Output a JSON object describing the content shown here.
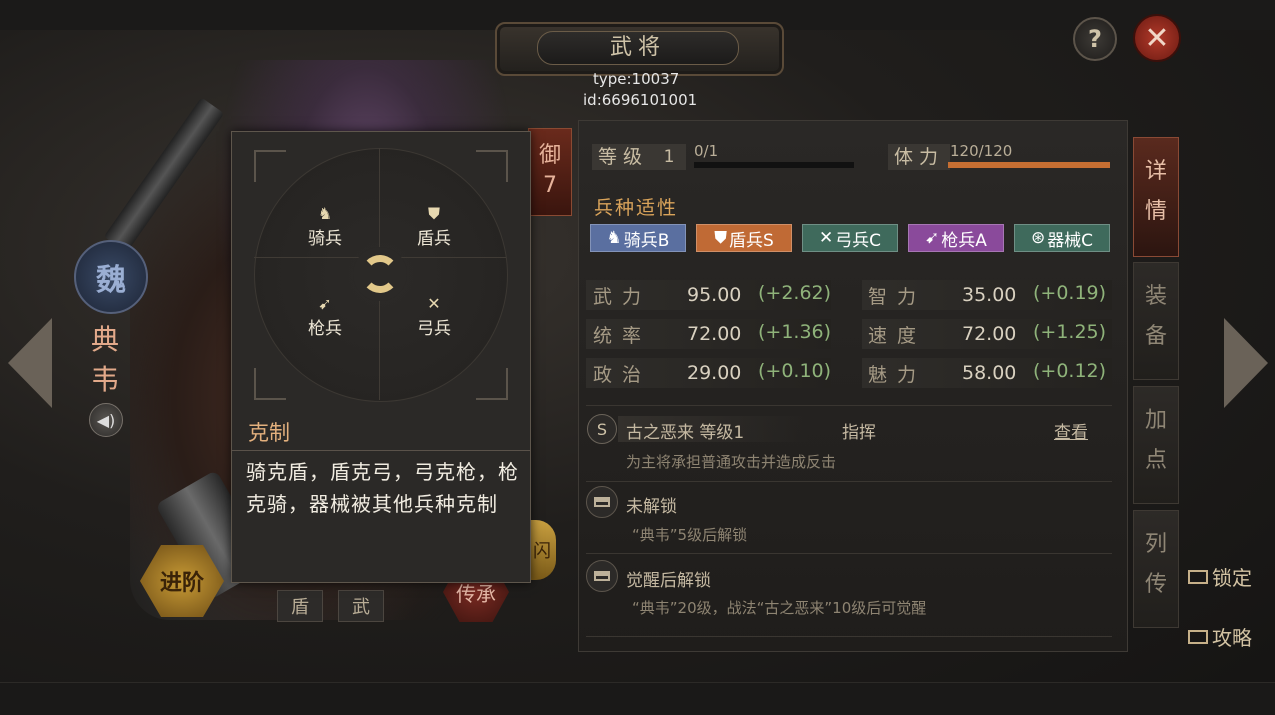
{
  "window": {
    "title": "武将",
    "debug_type": "type:10037",
    "debug_id": "id:6696101001",
    "help_label": "?",
    "close_label": "✕"
  },
  "hero": {
    "faction": "魏",
    "name_chars": [
      "典",
      "韦"
    ],
    "advance_label": "进阶",
    "tags": [
      "盾",
      "武"
    ],
    "inherit_label": "传承",
    "defense_tag": "御",
    "defense_value": "7",
    "side_gold_label": "闪"
  },
  "stats": {
    "level_label": "等级",
    "level_value": "1",
    "exp_text": "0/1",
    "exp_progress": 0,
    "stamina_label": "体力",
    "stamina_text": "120/120",
    "stamina_progress": 1.0
  },
  "troops": {
    "title": "兵种适性",
    "items": [
      {
        "glyph": "♞",
        "label": "骑兵B",
        "color": "#5a6fa0"
      },
      {
        "glyph": "⛊",
        "label": "盾兵S",
        "color": "#c06a35"
      },
      {
        "glyph": "✕",
        "label": "弓兵C",
        "color": "#3f6a5c"
      },
      {
        "glyph": "➹",
        "label": "枪兵A",
        "color": "#8a4a9b"
      },
      {
        "glyph": "⊛",
        "label": "器械C",
        "color": "#3f6a5c"
      }
    ]
  },
  "attributes": [
    {
      "label": "武力",
      "value": "95.00",
      "bonus": "(+2.62)"
    },
    {
      "label": "智力",
      "value": "35.00",
      "bonus": "(+0.19)"
    },
    {
      "label": "统率",
      "value": "72.00",
      "bonus": "(+1.36)"
    },
    {
      "label": "速度",
      "value": "72.00",
      "bonus": "(+1.25)"
    },
    {
      "label": "政治",
      "value": "29.00",
      "bonus": "(+0.10)"
    },
    {
      "label": "魅力",
      "value": "58.00",
      "bonus": "(+0.12)"
    }
  ],
  "skills": {
    "main": {
      "rank": "S",
      "name": "古之恶来 等级1",
      "type": "指挥",
      "view": "查看",
      "desc": "为主将承担普通攻击并造成反击"
    },
    "slot2": {
      "title": "未解锁",
      "desc": "“典韦”5级后解锁"
    },
    "slot3": {
      "title": "觉醒后解锁",
      "desc": "“典韦”20级，战法“古之恶来”10级后可觉醒"
    }
  },
  "tabs": [
    {
      "label": "详情",
      "active": true
    },
    {
      "label": "装备",
      "active": false
    },
    {
      "label": "加点",
      "active": false
    },
    {
      "label": "列传",
      "active": false
    }
  ],
  "side_links": {
    "lock": "锁定",
    "guide": "攻略"
  },
  "popup": {
    "units": [
      {
        "glyph": "♞",
        "label": "骑兵"
      },
      {
        "glyph": "⛊",
        "label": "盾兵"
      },
      {
        "glyph": "➹",
        "label": "枪兵"
      },
      {
        "glyph": "✕",
        "label": "弓兵"
      }
    ],
    "title": "克制",
    "body": "骑克盾，盾克弓，弓克枪，枪克骑，器械被其他兵种克制"
  }
}
